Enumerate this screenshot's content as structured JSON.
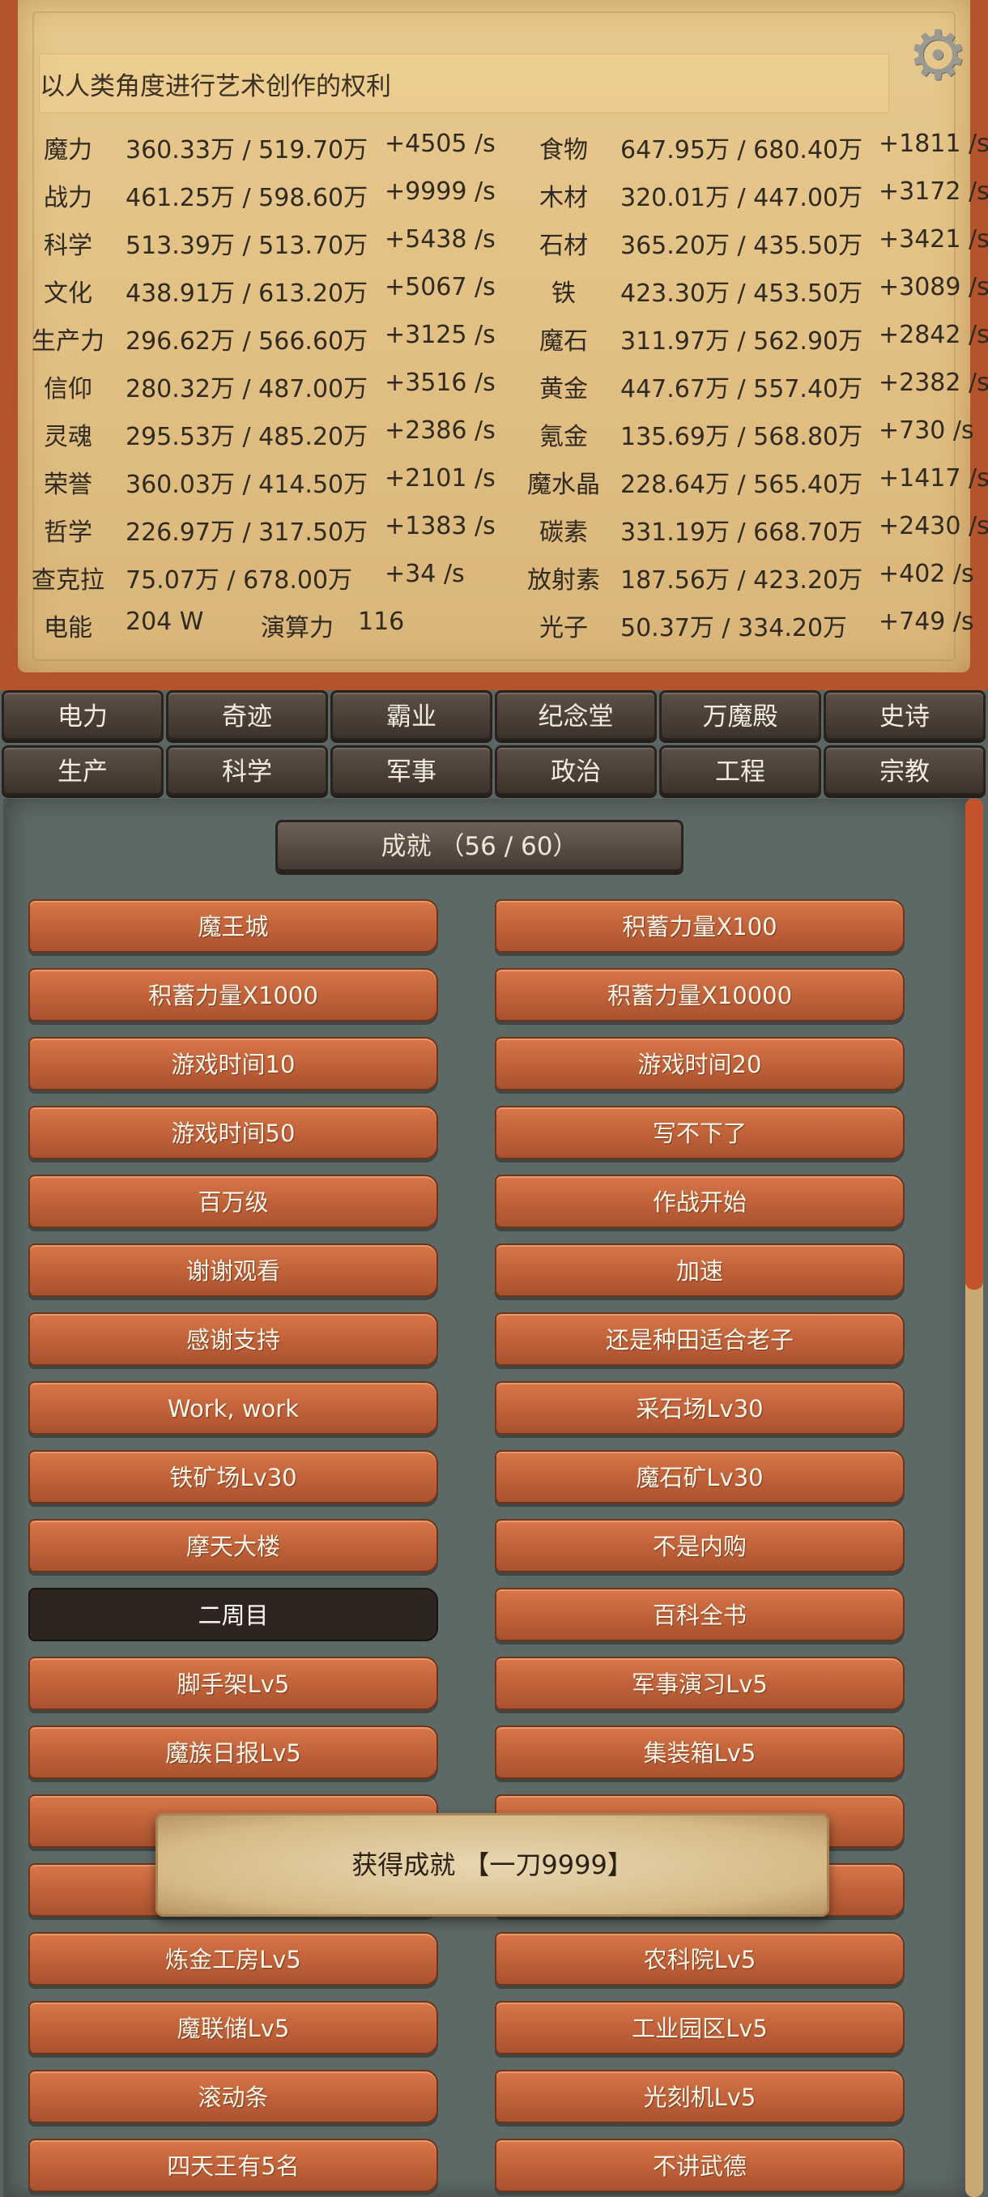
{
  "message": "以人类角度进行艺术创作的权利",
  "icons": {
    "settings": "gear-icon"
  },
  "resources": [
    {
      "left": {
        "name": "魔力",
        "value": "360.33万 / 519.70万",
        "rate": "+4505 /s"
      },
      "right": {
        "name": "食物",
        "value": "647.95万 / 680.40万",
        "rate": "+1811 /s"
      }
    },
    {
      "left": {
        "name": "战力",
        "value": "461.25万 / 598.60万",
        "rate": "+9999 /s"
      },
      "right": {
        "name": "木材",
        "value": "320.01万 / 447.00万",
        "rate": "+3172 /s"
      }
    },
    {
      "left": {
        "name": "科学",
        "value": "513.39万 / 513.70万",
        "rate": "+5438 /s"
      },
      "right": {
        "name": "石材",
        "value": "365.20万 / 435.50万",
        "rate": "+3421 /s"
      }
    },
    {
      "left": {
        "name": "文化",
        "value": "438.91万 / 613.20万",
        "rate": "+5067 /s"
      },
      "right": {
        "name": "铁",
        "value": "423.30万 / 453.50万",
        "rate": "+3089 /s"
      }
    },
    {
      "left": {
        "name": "生产力",
        "value": "296.62万 / 566.60万",
        "rate": "+3125 /s"
      },
      "right": {
        "name": "魔石",
        "value": "311.97万 / 562.90万",
        "rate": "+2842 /s"
      }
    },
    {
      "left": {
        "name": "信仰",
        "value": "280.32万 / 487.00万",
        "rate": "+3516 /s"
      },
      "right": {
        "name": "黄金",
        "value": "447.67万 / 557.40万",
        "rate": "+2382 /s"
      }
    },
    {
      "left": {
        "name": "灵魂",
        "value": "295.53万 / 485.20万",
        "rate": "+2386 /s"
      },
      "right": {
        "name": "氪金",
        "value": "135.69万 / 568.80万",
        "rate": "+730 /s"
      }
    },
    {
      "left": {
        "name": "荣誉",
        "value": "360.03万 / 414.50万",
        "rate": "+2101 /s"
      },
      "right": {
        "name": "魔水晶",
        "value": "228.64万 / 565.40万",
        "rate": "+1417 /s"
      }
    },
    {
      "left": {
        "name": "哲学",
        "value": "226.97万 / 317.50万",
        "rate": "+1383 /s"
      },
      "right": {
        "name": "碳素",
        "value": "331.19万 / 668.70万",
        "rate": "+2430 /s"
      }
    },
    {
      "left": {
        "name": "查克拉",
        "value": "75.07万 / 678.00万",
        "rate": "+34 /s"
      },
      "right": {
        "name": "放射素",
        "value": "187.56万 / 423.20万",
        "rate": "+402 /s"
      }
    },
    {
      "left": {
        "name": "电能",
        "value": "204 W",
        "extra_label": "演算力",
        "extra_value": "116"
      },
      "right": {
        "name": "光子",
        "value": "50.37万 / 334.20万",
        "rate": "+749 /s"
      }
    }
  ],
  "tabs_row1": [
    "电力",
    "奇迹",
    "霸业",
    "纪念堂",
    "万魔殿",
    "史诗"
  ],
  "tabs_row2": [
    "生产",
    "科学",
    "军事",
    "政治",
    "工程",
    "宗教"
  ],
  "achievements_title": "成就 （56 / 60）",
  "achievements": [
    [
      "魔王城",
      "积蓄力量X100"
    ],
    [
      "积蓄力量X1000",
      "积蓄力量X10000"
    ],
    [
      "游戏时间10",
      "游戏时间20"
    ],
    [
      "游戏时间50",
      "写不下了"
    ],
    [
      "百万级",
      "作战开始"
    ],
    [
      "谢谢观看",
      "加速"
    ],
    [
      "感谢支持",
      "还是种田适合老子"
    ],
    [
      "Work, work",
      "采石场Lv30"
    ],
    [
      "铁矿场Lv30",
      "魔石矿Lv30"
    ],
    [
      "摩天大楼",
      "不是内购"
    ],
    [
      "二周目",
      "百科全书"
    ],
    [
      "脚手架Lv5",
      "军事演习Lv5"
    ],
    [
      "魔族日报Lv5",
      "集装箱Lv5"
    ],
    [
      "",
      ""
    ],
    [
      "",
      ""
    ],
    [
      "炼金工房Lv5",
      "农科院Lv5"
    ],
    [
      "魔联储Lv5",
      "工业园区Lv5"
    ],
    [
      "滚动条",
      "光刻机Lv5"
    ],
    [
      "四天王有5名",
      "不讲武德"
    ]
  ],
  "toast": "获得成就 【一刀9999】",
  "scroll_position": 0.35
}
